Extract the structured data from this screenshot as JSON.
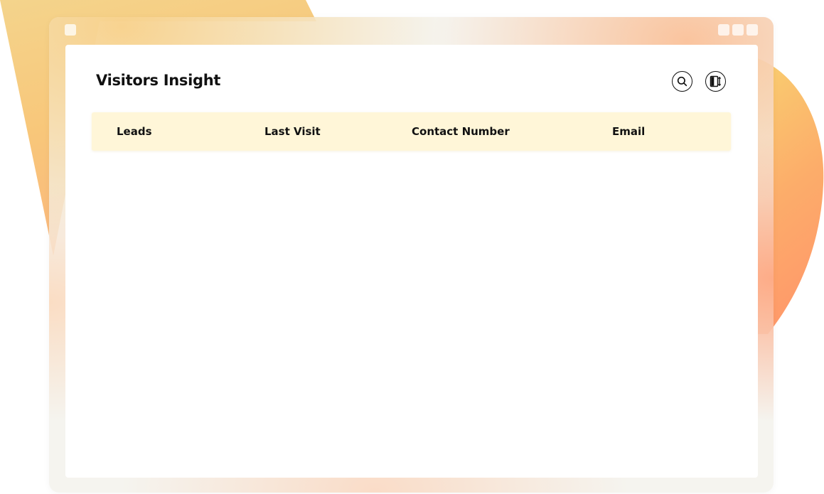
{
  "app": {
    "title": "Visitors Insight"
  },
  "toolbar": {
    "search_icon": "search-icon",
    "layout_icon": "column-resize-icon"
  },
  "table": {
    "columns": [
      {
        "label": "Leads"
      },
      {
        "label": "Last Visit"
      },
      {
        "label": "Contact Number"
      },
      {
        "label": "Email"
      }
    ],
    "rows": []
  },
  "colors": {
    "header_bg": "#fff6d8",
    "accent_orange": "#ffa060",
    "accent_yellow": "#f9cd6c",
    "frame": "#f3f1ec",
    "text": "#111111"
  }
}
